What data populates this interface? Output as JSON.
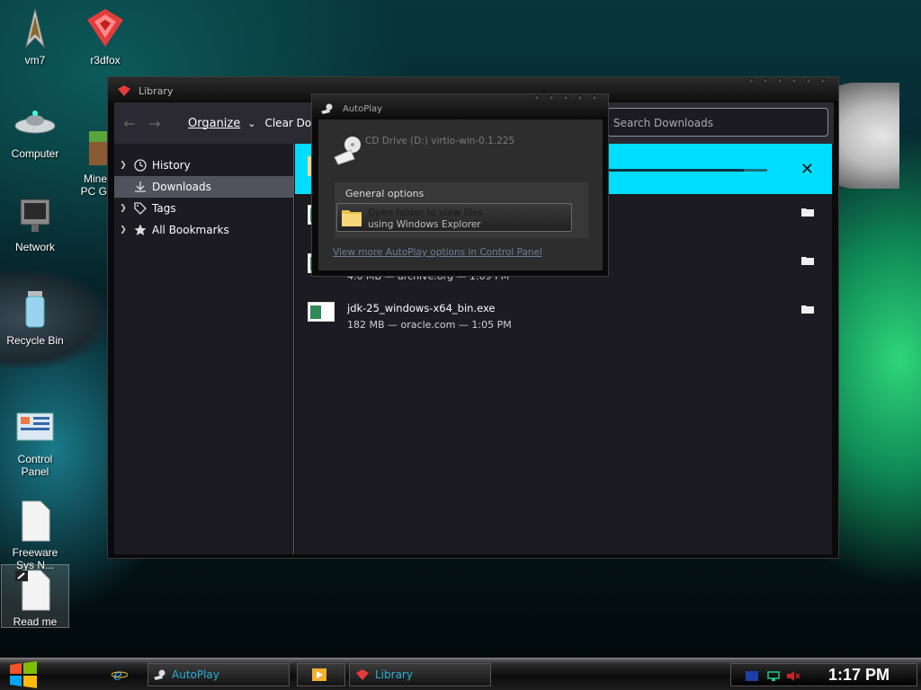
{
  "desktop": {
    "icons": [
      {
        "label": "vm7"
      },
      {
        "label": "r3dfox"
      },
      {
        "label": "Computer"
      },
      {
        "label": "Mine\nPC G"
      },
      {
        "label": "Network"
      },
      {
        "label": "Recycle Bin"
      },
      {
        "label": "Control\nPanel"
      },
      {
        "label": "Freeware\nSys N..."
      },
      {
        "label": "Read me"
      }
    ]
  },
  "library": {
    "title": "Library",
    "toolbar": {
      "organize": "Organize",
      "clear": "Clear Downlo",
      "search_placeholder": "Search Downloads"
    },
    "sidebar": [
      {
        "label": "History",
        "icon": "clock-icon"
      },
      {
        "label": "Downloads",
        "icon": "download-icon"
      },
      {
        "label": "Tags",
        "icon": "tag-icon"
      },
      {
        "label": "All Bookmarks",
        "icon": "star-icon"
      }
    ],
    "downloads": [
      {
        "name": "",
        "meta": "4.0 MB — archive.org — 1:09 PM"
      },
      {
        "name": "jdk-25_windows-x64_bin.exe",
        "meta": "182 MB — oracle.com — 1:05 PM"
      }
    ],
    "active_progress": 0.88
  },
  "autoplay": {
    "title": "AutoPlay",
    "drive": "CD Drive (D:) virtio-win-0.1.225",
    "group_title": "General options",
    "option_line1": "Open folder to view files",
    "option_line2": "using Windows Explorer",
    "link": "View more AutoPlay options in Control Panel"
  },
  "taskbar": {
    "buttons": [
      {
        "label": "AutoPlay"
      },
      {
        "label": ""
      },
      {
        "label": "Library"
      }
    ],
    "clock": "1:17 PM"
  },
  "colors": {
    "accent_cyan": "#00ddff",
    "taskbar_text": "#27b0d6"
  }
}
